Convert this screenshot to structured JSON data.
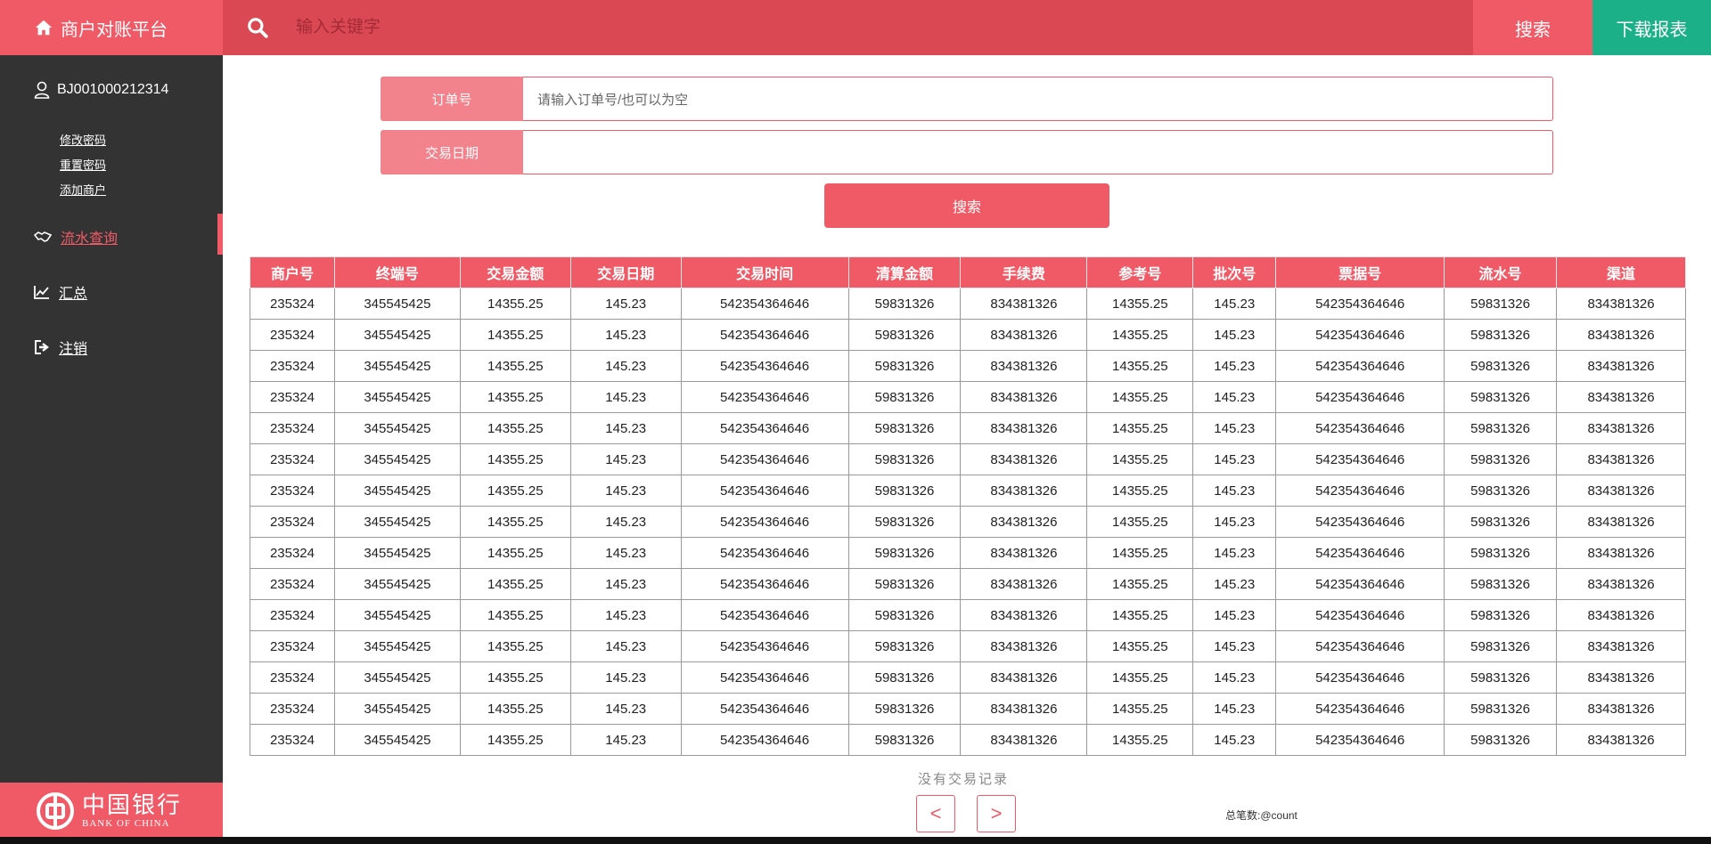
{
  "header": {
    "brand": "商户对账平台",
    "search_placeholder": "输入关键字",
    "search_button": "搜索",
    "download_button": "下载报表"
  },
  "sidebar": {
    "username": "BJ001000212314",
    "sublinks": [
      "修改密码",
      "重置密码",
      "添加商户"
    ],
    "nav": [
      "流水查询",
      "汇总",
      "注销"
    ],
    "bank_cn": "中国银行",
    "bank_en": "BANK OF CHINA"
  },
  "form": {
    "order_label": "订单号",
    "order_placeholder": "请输入订单号/也可以为空",
    "date_label": "交易日期",
    "search_button": "搜索"
  },
  "table": {
    "headers": [
      "商户号",
      "终端号",
      "交易金额",
      "交易日期",
      "交易时间",
      "清算金额",
      "手续费",
      "参考号",
      "批次号",
      "票据号",
      "流水号",
      "渠道"
    ],
    "row": [
      "235324",
      "345545425",
      "14355.25",
      "145.23",
      "542354364646",
      "59831326",
      "834381326",
      "14355.25",
      "145.23",
      "542354364646",
      "59831326",
      "834381326"
    ],
    "row_count": 15
  },
  "footer": {
    "no_record": "没有交易记录",
    "prev": "<",
    "next": ">",
    "total": "总笔数:@count"
  },
  "colors": {
    "brand": "#f05a66",
    "topbar": "#d94853",
    "download": "#1bb087",
    "sidebar": "#333333"
  }
}
